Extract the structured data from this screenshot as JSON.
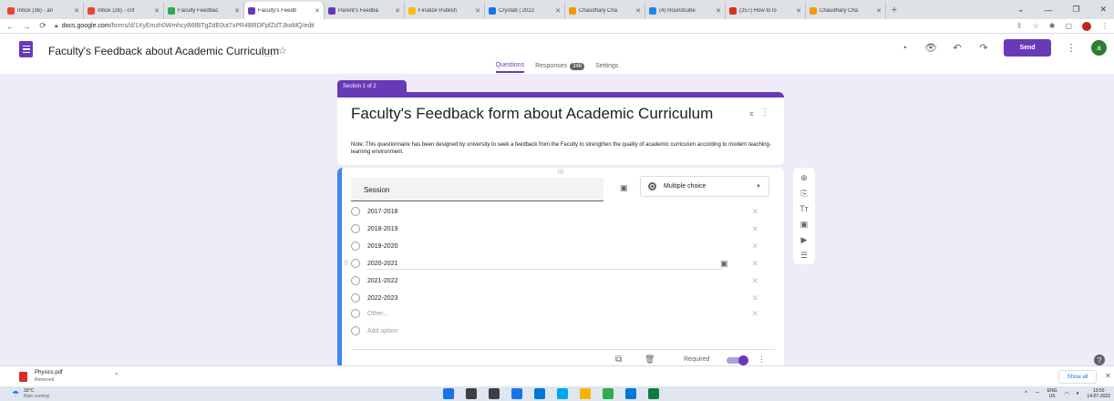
{
  "browser": {
    "tabs": [
      {
        "title": "Inbox (36) - an",
        "color": "#ea4335"
      },
      {
        "title": "Inbox (28) - crit",
        "color": "#ea4335"
      },
      {
        "title": "Faculty Feedbac",
        "color": "#34a853"
      },
      {
        "title": "Faculty's Feedb",
        "color": "#673ab7",
        "active": true
      },
      {
        "title": "Parent's Feedba",
        "color": "#673ab7"
      },
      {
        "title": "Finalize Publish",
        "color": "#fbbc04"
      },
      {
        "title": "Crystab | 2022",
        "color": "#1a73e8"
      },
      {
        "title": "Chaudhary Cha",
        "color": "#f29900"
      },
      {
        "title": "(4) Roundcube",
        "color": "#1e88e5"
      },
      {
        "title": "(257) How to lo",
        "color": "#d93025"
      },
      {
        "title": "Chaudhary Cha",
        "color": "#f29900"
      }
    ],
    "url_domain": "docs.google.com",
    "url_path": "/forms/d/1XyEmzh0WmhcyB6fBTgZdE0ut7xPR4BRDFpfZdTJkoMQ/edit"
  },
  "app": {
    "doc_title": "Faculty's Feedback about Academic Curriculum",
    "send_label": "Send",
    "avatar_letter": "a",
    "tabs": {
      "questions": "Questions",
      "responses": "Responses",
      "responses_count": "346",
      "settings": "Settings"
    }
  },
  "form": {
    "section_label": "Section 1 of 2",
    "title": "Faculty's Feedback form about Academic Curriculum",
    "description": "Note: This questionnaire has been designed by university to seek a feedback from the Faculty to strengthen the quality of academic curriculum according to modern teaching-learning environment.",
    "question": {
      "title": "Session",
      "type": "Multiple choice",
      "options": [
        "2017-2018",
        "2018-2019",
        "2019-2020",
        "2020-2021",
        "2021-2022",
        "2022-2023"
      ],
      "other_label": "Other...",
      "add_option_label": "Add option",
      "required_label": "Required",
      "required": true
    }
  },
  "downloads": {
    "file_name": "Physics.pdf",
    "status": "Removed",
    "show_all": "Show all"
  },
  "taskbar": {
    "temperature": "33°C",
    "condition": "Rain coming",
    "lang_top": "ENG",
    "lang_bottom": "US",
    "time": "13:50",
    "date": "14-07-2022",
    "app_colors": [
      "#1a73e8",
      "#3c4043",
      "#3c4043",
      "#1a73e8",
      "#0078d4",
      "#00a4ef",
      "#f4b400",
      "#34a853",
      "#0078d4",
      "#107c41"
    ]
  }
}
